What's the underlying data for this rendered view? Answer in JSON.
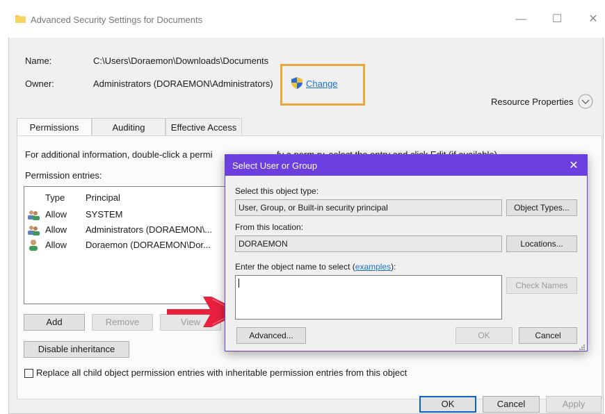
{
  "window": {
    "title": "Advanced Security Settings for Documents",
    "controls": {
      "minimize": "—",
      "maximize": "☐",
      "close": "✕"
    }
  },
  "info": {
    "name_label": "Name:",
    "name_value": "C:\\Users\\Doraemon\\Downloads\\Documents",
    "owner_label": "Owner:",
    "owner_value": "Administrators (DORAEMON\\Administrators)",
    "change_link": "Change",
    "resource_properties": "Resource Properties"
  },
  "tabs": [
    {
      "label": "Permissions",
      "active": true
    },
    {
      "label": "Auditing",
      "active": false
    },
    {
      "label": "Effective Access",
      "active": false
    }
  ],
  "permissions": {
    "info_text": "For additional information, double-click a permi",
    "info_text_tail": "fy a perm     ry, select the entry and click Edit (if available).",
    "entries_label": "Permission entries:",
    "columns": {
      "type": "Type",
      "principal": "Principal"
    },
    "rows": [
      {
        "type": "Allow",
        "principal": "SYSTEM",
        "icon": "group-users-icon"
      },
      {
        "type": "Allow",
        "principal": "Administrators (DORAEMON\\...",
        "icon": "group-users-icon"
      },
      {
        "type": "Allow",
        "principal": "Doraemon (DORAEMON\\Dor...",
        "icon": "user-icon"
      }
    ],
    "add_button": "Add",
    "remove_button": "Remove",
    "view_button": "View",
    "disable_inheritance_button": "Disable inheritance",
    "replace_checkbox_label": "Replace all child object permission entries with inheritable permission entries from this object",
    "replace_checked": false
  },
  "footer": {
    "ok": "OK",
    "cancel": "Cancel",
    "apply": "Apply"
  },
  "dialog": {
    "title": "Select User or Group",
    "close": "✕",
    "object_type_label": "Select this object type:",
    "object_type_value": "User, Group, or Built-in security principal",
    "object_types_button": "Object Types...",
    "location_label": "From this location:",
    "location_value": "DORAEMON",
    "locations_button": "Locations...",
    "enter_name_label": "Enter the object name to select (",
    "examples_link": "examples",
    "enter_name_label_tail": "):",
    "object_name_value": "",
    "check_names_button": "Check Names",
    "advanced_button": "Advanced...",
    "ok_button": "OK",
    "cancel_button": "Cancel"
  },
  "colors": {
    "accent": "#6b3fe0",
    "highlight": "#e8a93a",
    "arrow": "#e8213f",
    "link": "#1a6fd1"
  }
}
